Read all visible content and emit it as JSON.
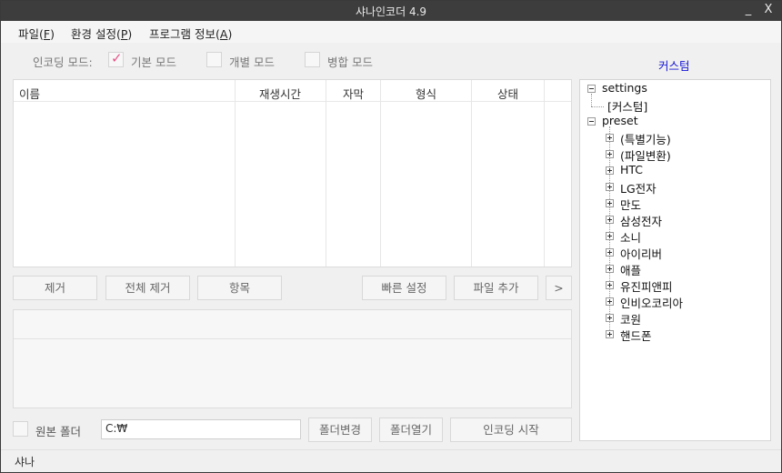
{
  "window": {
    "title": "샤나인코더 4.9",
    "minimize": "_",
    "close": "X"
  },
  "menu": [
    {
      "label": "파일",
      "key": "F"
    },
    {
      "label": "환경 설정",
      "key": "P"
    },
    {
      "label": "프로그램 정보",
      "key": "A"
    }
  ],
  "modes": {
    "label": "인코딩 모드:",
    "basic": {
      "label": "기본 모드",
      "checked": true
    },
    "individual": {
      "label": "개별 모드",
      "checked": false
    },
    "merge": {
      "label": "병합 모드",
      "checked": false
    }
  },
  "custom_link": "커스텀",
  "list": {
    "columns": [
      "이름",
      "재생시간",
      "자막",
      "형식",
      "상태"
    ]
  },
  "buttons": {
    "remove": "제거",
    "remove_all": "전체 제거",
    "item": "항목",
    "quick_settings": "빠른 설정",
    "add_file": "파일 추가",
    "more": ">",
    "change_folder": "폴더변경",
    "open_folder": "폴더열기",
    "start_encoding": "인코딩 시작"
  },
  "output": {
    "source_folder_label": "원본 폴더",
    "source_folder_checked": false,
    "path": "C:₩"
  },
  "tree": {
    "settings": "settings",
    "custom": "[커스텀]",
    "preset": "preset",
    "preset_items": [
      "(특별기능)",
      "(파일변환)",
      "HTC",
      "LG전자",
      "만도",
      "삼성전자",
      "소니",
      "아이리버",
      "애플",
      "유진피앤피",
      "인비오코리아",
      "코원",
      "핸드폰"
    ]
  },
  "status": "샤나"
}
